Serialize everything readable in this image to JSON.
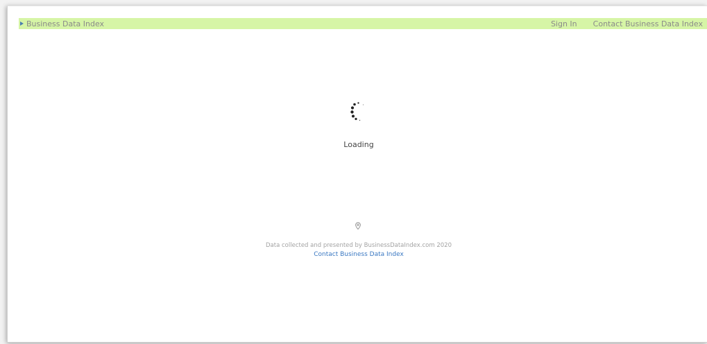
{
  "header": {
    "brand_label": "Business Data Index",
    "brand_icon": "play-triangle-icon",
    "sign_in_label": "Sign In",
    "contact_label": "Contact Business Data Index",
    "bar_color": "#d6f5a6"
  },
  "main": {
    "loading_label": "Loading",
    "spinner_icon": "loading-spinner-icon"
  },
  "footer": {
    "pin_icon": "map-pin-icon",
    "credit_text": "Data collected and presented by BusinessDataIndex.com 2020",
    "contact_link_label": "Contact Business Data Index",
    "link_color": "#3a78c2"
  }
}
